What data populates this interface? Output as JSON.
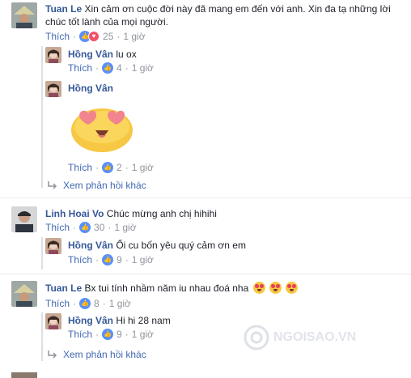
{
  "actions": {
    "like": "Thích",
    "view_more_replies": "Xem phản hồi khác"
  },
  "colors": {
    "link": "#365899",
    "like_blue": "#5890ff",
    "love_red": "#f25268",
    "meta_grey": "#90949c"
  },
  "comments": [
    {
      "author": "Tuan Le",
      "text_line1": "Xin cảm ơn cuộc đời này đã mang em đến với anh. Xin đa tạ những lời",
      "text_line2": "chúc tốt lành của mọi người.",
      "reaction_count": "25",
      "reaction_icons": [
        "like-icon",
        "love-icon"
      ],
      "time": "1 giờ",
      "replies": [
        {
          "author": "Hồng Vân",
          "text": "lu ox",
          "reaction_count": "4",
          "time": "1 giờ"
        },
        {
          "author": "Hồng Vân",
          "text": "",
          "sticker": "heart-eyes-sticker",
          "reaction_count": "2",
          "time": "1 giờ"
        }
      ]
    },
    {
      "author": "Linh Hoai Vo",
      "text": "Chúc mừng anh chị hihihi",
      "reaction_count": "30",
      "time": "1 giờ",
      "replies": [
        {
          "author": "Hồng Vân",
          "text": "Ối cu bốn yêu quý cảm ơn em",
          "reaction_count": "9",
          "time": "1 giờ"
        }
      ]
    },
    {
      "author": "Tuan Le",
      "text": "Bx tui tính nhầm năm iu nhau đoá nha",
      "emoji": [
        "heart-eyes-icon",
        "heart-eyes-icon",
        "heart-eyes-icon"
      ],
      "reaction_count": "8",
      "time": "1 giờ",
      "replies": [
        {
          "author": "Hồng Vân",
          "text": "Hi hi 28 nam",
          "reaction_count": "9",
          "time": "1 giờ"
        }
      ]
    }
  ],
  "watermark": "NGOISAO.VN"
}
